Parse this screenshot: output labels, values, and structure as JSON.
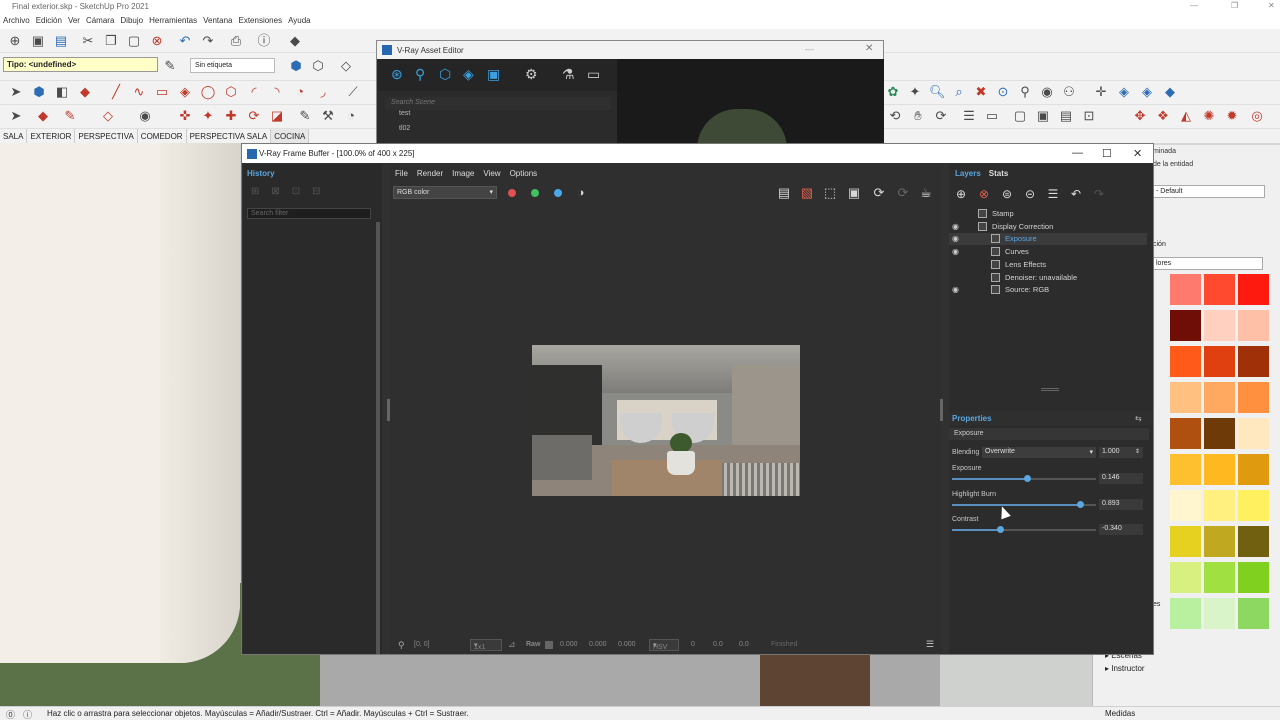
{
  "sketchup": {
    "title": "Final exterior.skp - SketchUp Pro 2021",
    "menu": [
      "Archivo",
      "Edición",
      "Ver",
      "Cámara",
      "Dibujo",
      "Herramientas",
      "Ventana",
      "Extensiones",
      "Ayuda"
    ],
    "tipo_field": "Tipo: <undefined>",
    "tag_field": "Sin etiqueta",
    "scene_tabs": [
      "SALA",
      "EXTERIOR",
      "PERSPECTIVA",
      "COMEDOR",
      "PERSPECTIVA SALA",
      "COCINA"
    ],
    "active_scene": "COCINA",
    "status_message": "Haz clic o arrastra para seleccionar objetos. Mayúsculas = Añadir/Sustraer. Ctrl = Añadir. Mayúsculas + Ctrl = Sustraer.",
    "status_measure": "Medidas"
  },
  "tray": {
    "header": "minada",
    "entity_label": "de la entidad",
    "default_value": "- Default",
    "section_label": "ción",
    "colors_select": "lores",
    "lower_label": "es",
    "sub_items": [
      "Escenas",
      "Instructor"
    ],
    "swatch_colors": [
      [
        "#ff7a6e",
        "#ff4a30",
        "#ff1a10"
      ],
      [
        "#6e0e06",
        "#ffd0c0",
        "#ffc0a8"
      ],
      [
        "#ff5a1a",
        "#e04010",
        "#a03008"
      ],
      [
        "#ffc080",
        "#ffa860",
        "#ff9040"
      ],
      [
        "#b05010",
        "#6e3a08",
        "#ffe8c0"
      ],
      [
        "#ffc030",
        "#ffb820",
        "#e09a10"
      ],
      [
        "#fff6d0",
        "#fff080",
        "#fff060"
      ],
      [
        "#e6d020",
        "#c0a820",
        "#706010"
      ],
      [
        "#d8f080",
        "#a0e040",
        "#80d020"
      ],
      [
        "#b8f0a0",
        "#d8f4c8",
        "#8cd860"
      ]
    ]
  },
  "asset_editor": {
    "title": "V-Ray Asset Editor",
    "search_placeholder": "Search Scene",
    "items": [
      "test",
      "tl02"
    ]
  },
  "vfb": {
    "title": "V-Ray Frame Buffer - [100.0% of 400 x 225]",
    "history_title": "History",
    "search_filter": "Search filter",
    "menu": [
      "File",
      "Render",
      "Image",
      "View",
      "Options"
    ],
    "channel": "RGB color",
    "dot_colors": [
      "#e05050",
      "#40c060",
      "#4aa8e8"
    ],
    "bottom": {
      "coords": "[0, 0]",
      "zoom": "1x1",
      "raw_label": "Raw",
      "raw_values": [
        "0.000",
        "0.000",
        "0.000"
      ],
      "color_mode": "HSV",
      "hsv_values": [
        "0",
        "0.0",
        "0.0"
      ],
      "status": "Finished"
    },
    "tabs": [
      "Layers",
      "Stats"
    ],
    "layers": [
      {
        "label": "Stamp",
        "eye": false,
        "indent": 0,
        "selected": false
      },
      {
        "label": "Display Correction",
        "eye": true,
        "indent": 0,
        "selected": false
      },
      {
        "label": "Exposure",
        "eye": true,
        "indent": 1,
        "selected": true
      },
      {
        "label": "Curves",
        "eye": true,
        "indent": 1,
        "selected": false
      },
      {
        "label": "Lens Effects",
        "eye": false,
        "indent": 1,
        "selected": false
      },
      {
        "label": "Denoiser: unavailable",
        "eye": false,
        "indent": 1,
        "selected": false
      },
      {
        "label": "Source: RGB",
        "eye": true,
        "indent": 1,
        "selected": false
      }
    ],
    "properties": {
      "title": "Properties",
      "section": "Exposure",
      "blending_label": "Blending",
      "blending_mode": "Overwrite",
      "blending_amount": "1.000",
      "sliders": [
        {
          "label": "Exposure",
          "value": "0.146",
          "position": 0.52
        },
        {
          "label": "Highlight Burn",
          "value": "0.893",
          "position": 0.89
        },
        {
          "label": "Contrast",
          "value": "-0.340",
          "position": 0.33
        }
      ]
    }
  }
}
